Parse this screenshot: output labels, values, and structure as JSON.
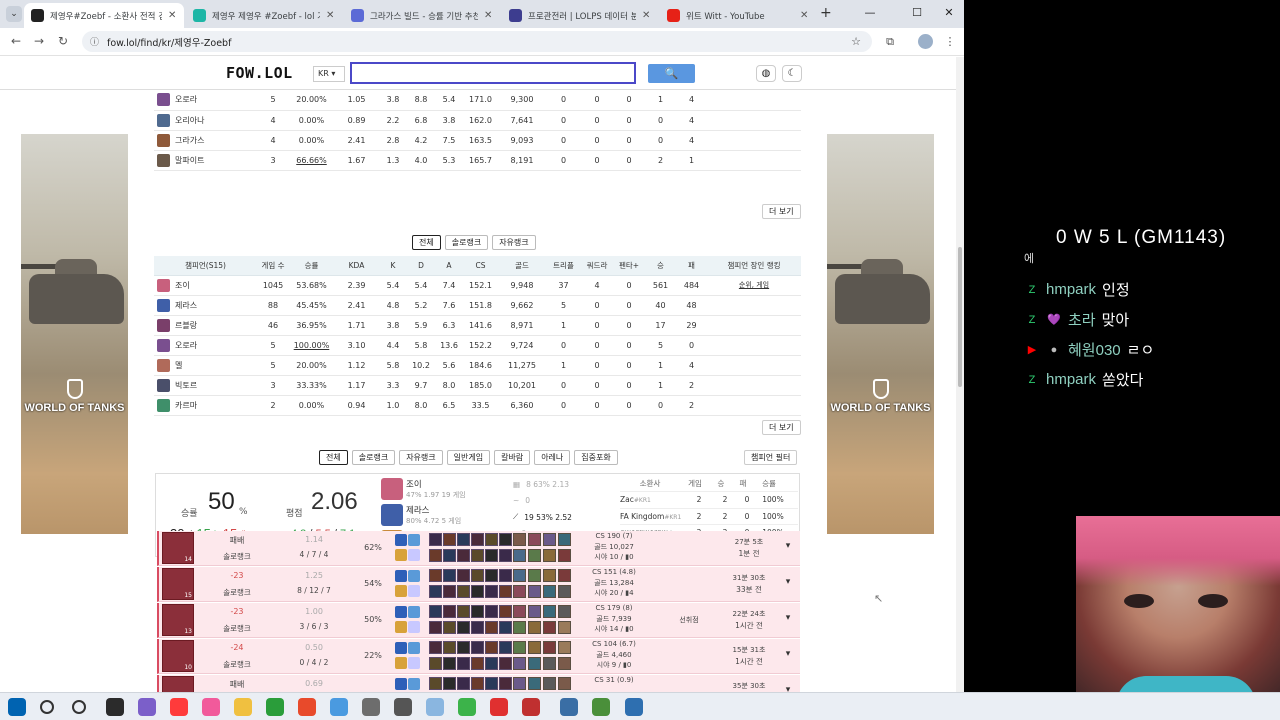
{
  "browser": {
    "tabs": [
      {
        "title": "제영우#Zoebf - 소환사 전적 검",
        "color": "#222222"
      },
      {
        "title": "제영우 제영우 #Zoebf - lol 기록",
        "color": "#1db6a6"
      },
      {
        "title": "그라가스 빌드 - 승률 기반 추천",
        "color": "#5b6ad6"
      },
      {
        "title": "프로관전러 | LOLPS 데이터 분석",
        "color": "#3d3d8f"
      },
      {
        "title": "위트 Witt - YouTube",
        "color": "#e62117"
      }
    ],
    "close_glyph": "✕",
    "new_tab": "+",
    "minimize": "—",
    "maximize": "☐",
    "close": "✕",
    "url": "fow.lol/find/kr/제영우-Zoebf"
  },
  "site": {
    "logo": "FOW.LOL",
    "region": "KR ▾",
    "search_placeholder": "",
    "search_icon": "🔍"
  },
  "table1": {
    "rows": [
      {
        "name": "오로라",
        "games": "5",
        "wr": "20.00%",
        "wr_class": "",
        "kda": "1.05",
        "kda_class": "grey",
        "k": "3.8",
        "d": "8.8",
        "a": "5.4",
        "cs": "171.0",
        "gold": "9,300",
        "c1": "0",
        "c2": "0",
        "c3": "0",
        "c4": "1",
        "c5": "4",
        "color": "#7a4f8f"
      },
      {
        "name": "오리아나",
        "games": "4",
        "wr": "0.00%",
        "wr_class": "",
        "kda": "0.89",
        "kda_class": "grey",
        "k": "2.2",
        "d": "6.8",
        "a": "3.8",
        "cs": "162.0",
        "gold": "7,641",
        "c1": "0",
        "c2": "0",
        "c3": "0",
        "c4": "0",
        "c5": "4",
        "color": "#4f6a8f"
      },
      {
        "name": "그라가스",
        "games": "4",
        "wr": "0.00%",
        "wr_class": "",
        "kda": "2.41",
        "kda_class": "green",
        "k": "2.8",
        "d": "4.2",
        "a": "7.5",
        "cs": "163.5",
        "gold": "9,093",
        "c1": "0",
        "c2": "0",
        "c3": "0",
        "c4": "0",
        "c5": "4",
        "color": "#8f5a3a"
      },
      {
        "name": "말파이트",
        "games": "3",
        "wr": "66.66%",
        "wr_class": "red uline",
        "kda": "1.67",
        "kda_class": "grey",
        "k": "1.3",
        "d": "4.0",
        "a": "5.3",
        "cs": "165.7",
        "gold": "8,191",
        "c1": "0",
        "c2": "0",
        "c3": "0",
        "c4": "2",
        "c5": "1",
        "color": "#6b5a4a"
      }
    ],
    "more": "더 보기"
  },
  "queue_tabs": [
    "전체",
    "솔로랭크",
    "자유랭크"
  ],
  "table2": {
    "headers": [
      "챔피언(S15)",
      "게임 수",
      "승률",
      "KDA",
      "K",
      "D",
      "A",
      "CS",
      "골드",
      "트리플",
      "쿼드라",
      "펜타+",
      "승",
      "패",
      "챔피언 장인 랭킹"
    ],
    "rows": [
      {
        "name": "조이",
        "games": "1045",
        "wr": "53.68%",
        "wr_class": "red",
        "kda": "2.39",
        "kda_class": "green",
        "k": "5.4",
        "d": "5.4",
        "a": "7.4",
        "cs": "152.1",
        "gold": "9,948",
        "c1": "37",
        "c2": "4",
        "c3": "0",
        "c4": "561",
        "c5": "484",
        "rank": "순위, 게임",
        "color": "#c8607d"
      },
      {
        "name": "제라스",
        "games": "88",
        "wr": "45.45%",
        "wr_class": "",
        "kda": "2.41",
        "kda_class": "green",
        "k": "4.8",
        "d": "5.2",
        "a": "7.6",
        "cs": "151.8",
        "gold": "9,662",
        "c1": "5",
        "c2": "0",
        "c3": "0",
        "c4": "40",
        "c5": "48",
        "rank": "",
        "color": "#3f5fa8"
      },
      {
        "name": "르블랑",
        "games": "46",
        "wr": "36.95%",
        "wr_class": "",
        "kda": "1.71",
        "kda_class": "grey",
        "k": "3.8",
        "d": "5.9",
        "a": "6.3",
        "cs": "141.6",
        "gold": "8,971",
        "c1": "1",
        "c2": "0",
        "c3": "0",
        "c4": "17",
        "c5": "29",
        "rank": "",
        "color": "#7a3f6a"
      },
      {
        "name": "오로라",
        "games": "5",
        "wr": "100.00%",
        "wr_class": "red uline",
        "kda": "3.10",
        "kda_class": "blue",
        "k": "4.4",
        "d": "5.8",
        "a": "13.6",
        "cs": "152.2",
        "gold": "9,724",
        "c1": "0",
        "c2": "0",
        "c3": "0",
        "c4": "5",
        "c5": "0",
        "rank": "",
        "color": "#7a4f8f"
      },
      {
        "name": "멜",
        "games": "5",
        "wr": "20.00%",
        "wr_class": "",
        "kda": "1.12",
        "kda_class": "grey",
        "k": "5.8",
        "d": "10.2",
        "a": "5.6",
        "cs": "184.6",
        "gold": "11,275",
        "c1": "1",
        "c2": "0",
        "c3": "0",
        "c4": "1",
        "c5": "4",
        "rank": "",
        "color": "#b06a5a"
      },
      {
        "name": "빅토르",
        "games": "3",
        "wr": "33.33%",
        "wr_class": "",
        "kda": "1.17",
        "kda_class": "grey",
        "k": "3.3",
        "d": "9.7",
        "a": "8.0",
        "cs": "185.0",
        "gold": "10,201",
        "c1": "0",
        "c2": "0",
        "c3": "0",
        "c4": "1",
        "c5": "2",
        "rank": "",
        "color": "#4a4f6a"
      },
      {
        "name": "카르마",
        "games": "2",
        "wr": "0.00%",
        "wr_class": "",
        "kda": "0.94",
        "kda_class": "grey",
        "k": "1.0",
        "d": "8.0",
        "a": "6.5",
        "cs": "33.5",
        "gold": "6,360",
        "c1": "0",
        "c2": "0",
        "c3": "0",
        "c4": "0",
        "c5": "2",
        "rank": "",
        "color": "#3f8f6a"
      }
    ],
    "more": "더 보기"
  },
  "mode_tabs": [
    "전체",
    "솔로랭크",
    "자유랭크",
    "일반게임",
    "칼바람",
    "아레나",
    "집중포화"
  ],
  "champ_filter": "챔피언 필터",
  "summary": {
    "wr_label": "승률",
    "wr_value": "50",
    "wr_unit": "%",
    "games": "30",
    "games_unit": "전",
    "wins": "15",
    "wins_unit": "승",
    "losses": "15",
    "losses_unit": "패",
    "avg_label": "평점",
    "avg_value": "2.06",
    "kda_k": "4.3",
    "kda_d": "5.5",
    "kda_a": "7.1",
    "slash": "/",
    "top_champs": [
      {
        "name": "조이",
        "stats": "47%  1.97  19 게임",
        "color": "#c8607d"
      },
      {
        "name": "제라스",
        "stats": "80%  4.72  5 게임",
        "color": "#3f5fa8"
      },
      {
        "name": "직스",
        "stats": "100%  1.75  1 게임",
        "color": "#c98a3a"
      }
    ],
    "lanes": [
      {
        "text": "8  63%  2.13",
        "strong": false
      },
      {
        "text": "0",
        "strong": false
      },
      {
        "text": "19  53%  2.52",
        "strong": true
      },
      {
        "text": "0",
        "strong": false
      },
      {
        "text": "3  0%  0.92",
        "strong": false
      }
    ],
    "duo_headers": [
      "소환사",
      "게임",
      "승",
      "패",
      "승률"
    ],
    "duo": [
      {
        "name": "Zac",
        "tag": "#KR1",
        "g": "2",
        "w": "2",
        "l": "0",
        "wr": "100%"
      },
      {
        "name": "FA Kingdom",
        "tag": "#KR1",
        "g": "2",
        "w": "2",
        "l": "0",
        "wr": "100%"
      },
      {
        "name": "qwerqwerqw",
        "tag": "#g...",
        "g": "2",
        "w": "2",
        "l": "0",
        "wr": "100%"
      },
      {
        "name": "코끼리",
        "tag": "#KR 1",
        "g": "2",
        "w": "2",
        "l": "0",
        "wr": "100%"
      }
    ]
  },
  "matches": [
    {
      "lp": "패배",
      "queue": "솔로랭크",
      "kda_ratio": "1.14",
      "kda": "4 / 7 / 4",
      "kp": "62%",
      "cs": "CS 190 (7)",
      "gold": "골드 10,027",
      "vision": "시야 10 / ▮0",
      "tag": "",
      "duration": "27분 5초",
      "ago": "1분 전",
      "level": "14"
    },
    {
      "lp": "-23",
      "queue": "솔로랭크",
      "kda_ratio": "1.25",
      "kda": "8 / 12 / 7",
      "kp": "54%",
      "cs": "CS 151 (4.8)",
      "gold": "골드 13,284",
      "vision": "시야 20 / ▮4",
      "tag": "",
      "duration": "31분 30초",
      "ago": "33분 전",
      "level": "15"
    },
    {
      "lp": "-23",
      "queue": "솔로랭크",
      "kda_ratio": "1.00",
      "kda": "3 / 6 / 3",
      "kp": "50%",
      "cs": "CS 179 (8)",
      "gold": "골드 7,939",
      "vision": "시야 14 / ▮0",
      "tag": "선취점",
      "duration": "22분 24초",
      "ago": "1시간 전",
      "level": "13"
    },
    {
      "lp": "-24",
      "queue": "솔로랭크",
      "kda_ratio": "0.50",
      "kda": "0 / 4 / 2",
      "kp": "22%",
      "cs": "CS 104 (6.7)",
      "gold": "골드 4,460",
      "vision": "시야 9 / ▮0",
      "tag": "",
      "duration": "15분 31초",
      "ago": "1시간 전",
      "level": "10"
    },
    {
      "lp": "패배",
      "queue": "",
      "kda_ratio": "0.69",
      "kda": "",
      "kp": "",
      "cs": "CS 31 (0.9)",
      "gold": "",
      "vision": "",
      "tag": "",
      "duration": "35분 30초",
      "ago": "",
      "level": ""
    }
  ],
  "stream": {
    "title": "0 W 5 L (GM1143)",
    "partial": "에",
    "chat": [
      {
        "badge": "Z",
        "badge_color": "#2ecc71",
        "extra": "",
        "user": "hmpark",
        "msg": "인정"
      },
      {
        "badge": "Z",
        "badge_color": "#2ecc71",
        "extra": "💜",
        "user": "초라",
        "msg": "맞아"
      },
      {
        "badge": "▶",
        "badge_color": "#ff0000",
        "extra": "●",
        "user": "혜원030",
        "msg": "ㄹㅇ"
      },
      {
        "badge": "Z",
        "badge_color": "#2ecc71",
        "extra": "",
        "user": "hmpark",
        "msg": "쏟았다"
      }
    ]
  },
  "ad": {
    "logo": "WORLD OF TANKS"
  },
  "taskbar": {
    "apps": [
      "#0063b1",
      "#222222",
      "#666666",
      "#2b2b2b",
      "#7b5fc9",
      "#ff3b3b",
      "#f15a9b",
      "#f0c040",
      "#2a9d3a",
      "#e84a2b",
      "#4a9ae0",
      "#6d6d6d",
      "#555555",
      "#8ab6e0",
      "#3cb34a",
      "#e03030",
      "#c03030",
      "#3a6ea5",
      "#4a8f3a",
      "#2e6fb0"
    ]
  }
}
